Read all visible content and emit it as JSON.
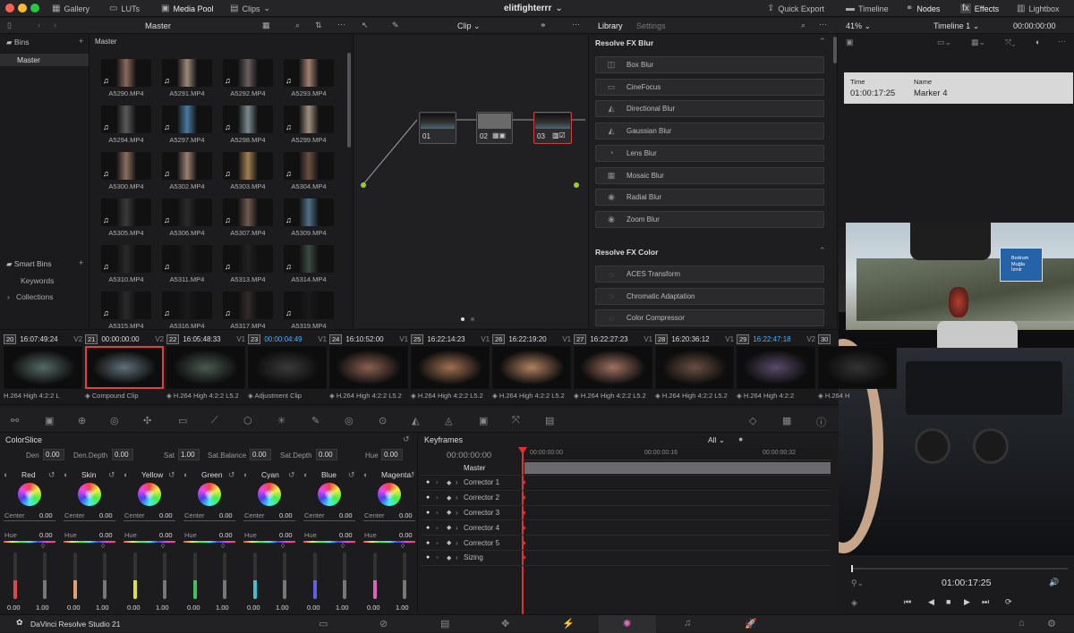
{
  "app": {
    "title": "elitfighterrr",
    "name": "DaVinci Resolve Studio 21"
  },
  "topbar": {
    "gallery": "Gallery",
    "luts": "LUTs",
    "media_pool": "Media Pool",
    "clips": "Clips",
    "quick_export": "Quick Export",
    "timeline": "Timeline",
    "nodes": "Nodes",
    "effects": "Effects",
    "lightbox": "Lightbox"
  },
  "mediapool": {
    "bin_label": "Master",
    "bins_title": "Bins",
    "bin_master": "Master",
    "smart_bins": "Smart Bins",
    "keywords": "Keywords",
    "collections": "Collections",
    "path": "Master",
    "clips": [
      "A5290.MP4",
      "A5291.MP4",
      "A5292.MP4",
      "A5293.MP4",
      "A5294.MP4",
      "A5297.MP4",
      "A5298.MP4",
      "A5299.MP4",
      "A5300.MP4",
      "A5302.MP4",
      "A5303.MP4",
      "A5304.MP4",
      "A5305.MP4",
      "A5306.MP4",
      "A5307.MP4",
      "A5309.MP4",
      "A5310.MP4",
      "A5311.MP4",
      "A5313.MP4",
      "A5314.MP4",
      "A5315.MP4",
      "A5316.MP4",
      "A5317.MP4",
      "A5319.MP4"
    ]
  },
  "nodes": {
    "mode": "Clip",
    "node1": "01",
    "node2": "02",
    "node3": "03"
  },
  "library": {
    "tab_library": "Library",
    "tab_settings": "Settings",
    "section_blur": "Resolve FX Blur",
    "blur": [
      "Box Blur",
      "CineFocus",
      "Directional Blur",
      "Gaussian Blur",
      "Lens Blur",
      "Mosaic Blur",
      "Radial Blur",
      "Zoom Blur"
    ],
    "section_color": "Resolve FX Color",
    "color": [
      "ACES Transform",
      "Chromatic Adaptation",
      "Color Compressor"
    ]
  },
  "viewer": {
    "zoom": "41%",
    "timeline_name": "Timeline 1",
    "timecode_top": "00:00:00:00",
    "marker_time_label": "Time",
    "marker_time": "01:00:17:25",
    "marker_name_label": "Name",
    "marker_name": "Marker 4",
    "timecode": "01:00:17:25",
    "sign": "Bodrum\nMuğla\nİzmir"
  },
  "strip": [
    {
      "num": "20",
      "tc": "16:07:49:24",
      "track": "V2",
      "codec": "H.264 High 4:2:2 L"
    },
    {
      "num": "21",
      "tc": "00:00:00:00",
      "track": "V2",
      "codec": "Compound Clip"
    },
    {
      "num": "22",
      "tc": "16:05:48:33",
      "track": "V1",
      "codec": "H.264 High 4:2:2 L5.2"
    },
    {
      "num": "23",
      "tc": "00:00:04:49",
      "track": "V1",
      "codec": "Adjustment Clip"
    },
    {
      "num": "24",
      "tc": "16:10:52:00",
      "track": "V1",
      "codec": "H.264 High 4:2:2 L5.2"
    },
    {
      "num": "25",
      "tc": "16:22:14:23",
      "track": "V1",
      "codec": "H.264 High 4:2:2 L5.2"
    },
    {
      "num": "26",
      "tc": "16:22:19:20",
      "track": "V1",
      "codec": "H.264 High 4:2:2 L5.2"
    },
    {
      "num": "27",
      "tc": "16:22:27:23",
      "track": "V1",
      "codec": "H.264 High 4:2:2 L5.2"
    },
    {
      "num": "28",
      "tc": "16:20:36:12",
      "track": "V1",
      "codec": "H.264 High 4:2:2 L5.2"
    },
    {
      "num": "29",
      "tc": "16:22:47:18",
      "track": "V2",
      "codec": "H.264 High 4:2:2"
    },
    {
      "num": "30",
      "tc": "",
      "track": "",
      "codec": "H.264 H"
    }
  ],
  "colorslice": {
    "title": "ColorSlice",
    "den_label": "Den",
    "den": "0.00",
    "dendepth_label": "Den.Depth",
    "dendepth": "0.00",
    "sat_label": "Sat",
    "sat": "1.00",
    "satbal_label": "Sat.Balance",
    "satbal": "0.00",
    "satdepth_label": "Sat.Depth",
    "satdepth": "0.00",
    "hue_label": "Hue",
    "hue": "0.00",
    "slices": [
      {
        "name": "Red",
        "color": "#e04848"
      },
      {
        "name": "Skin",
        "color": "#e0a070"
      },
      {
        "name": "Yellow",
        "color": "#e0e040"
      },
      {
        "name": "Green",
        "color": "#40c060"
      },
      {
        "name": "Cyan",
        "color": "#40c0d0"
      },
      {
        "name": "Blue",
        "color": "#6060e0"
      },
      {
        "name": "Magenta",
        "color": "#e060c0"
      }
    ],
    "center_label": "Center",
    "center_val": "0.00",
    "hue_row_label": "Hue",
    "hue_row_val": "0.00",
    "v1": "0.00",
    "v2": "1.00"
  },
  "keyframes": {
    "title": "Keyframes",
    "filter": "All",
    "tc": "00:00:00:00",
    "ruler": [
      "00:00:00:00",
      "00:00:00:16",
      "00:00:00:32"
    ],
    "rows": [
      "Master",
      "Corrector 1",
      "Corrector 2",
      "Corrector 3",
      "Corrector 4",
      "Corrector 5",
      "Sizing"
    ]
  }
}
